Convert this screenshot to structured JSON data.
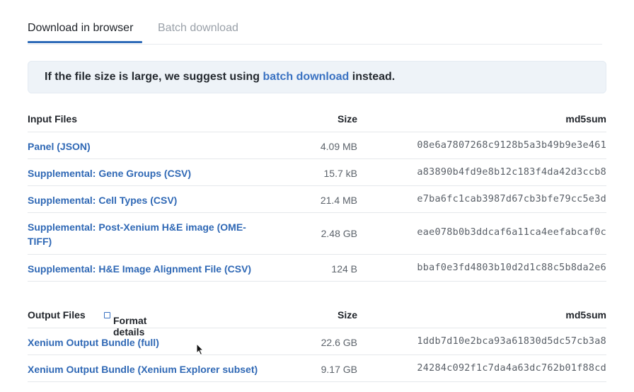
{
  "tabs": [
    {
      "label": "Download in browser",
      "active": true
    },
    {
      "label": "Batch download",
      "active": false
    }
  ],
  "notice": {
    "before": "If the file size is large, we suggest using ",
    "link": "batch download",
    "after": " instead."
  },
  "input_files": {
    "heading": "Input Files",
    "size_header": "Size",
    "md5_header": "md5sum",
    "rows": [
      {
        "name": "Panel (JSON)",
        "size": "4.09 MB",
        "md5": "08e6a7807268c9128b5a3b49b9e3e461"
      },
      {
        "name": "Supplemental: Gene Groups (CSV)",
        "size": "15.7 kB",
        "md5": "a83890b4fd9e8b12c183f4da42d3ccb8"
      },
      {
        "name": "Supplemental: Cell Types (CSV)",
        "size": "21.4 MB",
        "md5": "e7ba6fc1cab3987d67cb3bfe79cc5e3d"
      },
      {
        "name": "Supplemental: Post-Xenium H&E image (OME-TIFF)",
        "size": "2.48 GB",
        "md5": "eae078b0b3ddcaf6a11ca4eefabcaf0c"
      },
      {
        "name": "Supplemental: H&E Image Alignment File (CSV)",
        "size": "124 B",
        "md5": "bbaf0e3fd4803b10d2d1c88c5b8da2e6"
      }
    ]
  },
  "output_files": {
    "heading": "Output Files",
    "format_link": "Format details",
    "size_header": "Size",
    "md5_header": "md5sum",
    "rows": [
      {
        "name": "Xenium Output Bundle (full)",
        "size": "22.6 GB",
        "md5": "1ddb7d10e2bca93a61830d5dc57cb3a8"
      },
      {
        "name": "Xenium Output Bundle (Xenium Explorer subset)",
        "size": "9.17 GB",
        "md5": "24284c092f1c7da4a63dc762b01f88cd"
      }
    ]
  },
  "colors": {
    "link": "#2f68b5",
    "accent": "#2f6bb8",
    "notice_bg": "#eef3f8"
  }
}
